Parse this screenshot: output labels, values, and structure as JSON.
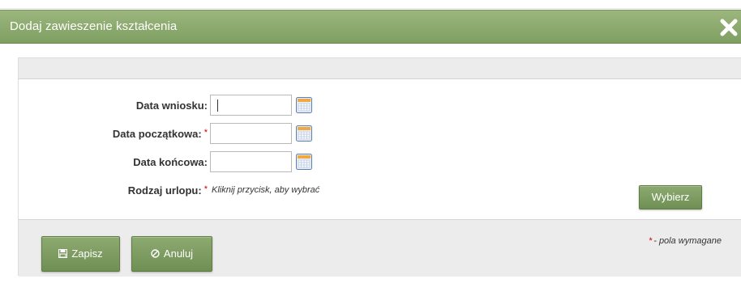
{
  "dialog": {
    "title": "Dodaj zawieszenie kształcenia"
  },
  "form": {
    "fields": [
      {
        "label": "Data wniosku:",
        "required": false,
        "value": ""
      },
      {
        "label": "Data początkowa:",
        "required": true,
        "value": ""
      },
      {
        "label": "Data końcowa:",
        "required": false,
        "value": ""
      }
    ],
    "leave_type": {
      "label": "Rodzaj urlopu:",
      "required": true,
      "hint": "Kliknij przycisk, aby wybrać",
      "button_label": "Wybierz"
    },
    "required_marker": "*"
  },
  "footer": {
    "save_label": "Zapisz",
    "cancel_label": "Anuluj",
    "required_note": "- pola wymagane"
  },
  "colors": {
    "titlebar": "#8cab6f",
    "button": "#7e9c62",
    "required": "#cc0000"
  },
  "icons": {
    "close": "close-icon",
    "calendar": "calendar-icon",
    "save": "floppy-disk-icon",
    "cancel": "cancel-circle-icon"
  }
}
